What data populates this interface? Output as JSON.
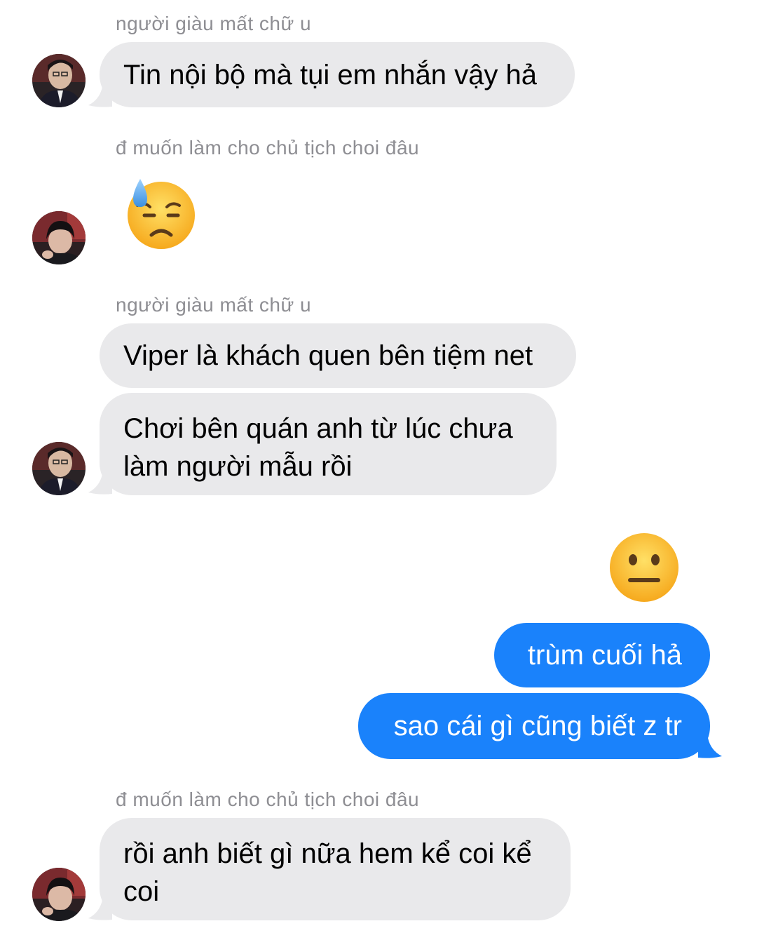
{
  "messages": [
    {
      "sender": "người giàu mất chữ u",
      "text": "Tin nội bộ mà tụi em nhắn vậy hả"
    },
    {
      "sender": "đ muốn làm cho chủ tịch choi đâu",
      "emoji": "downcast-face-with-sweat-emoji"
    },
    {
      "sender": "người giàu mất chữ u",
      "text": "Viper là khách quen bên tiệm net"
    },
    {
      "line1": "Chơi bên quán anh từ lúc chưa",
      "line2": "làm người mẫu rồi"
    },
    {
      "emoji": "neutral-face-emoji"
    },
    {
      "text": "trùm cuối hả"
    },
    {
      "text": "sao cái gì cũng biết z tr"
    },
    {
      "sender": "đ muốn làm cho chủ tịch choi đâu",
      "line1": "rồi anh biết gì nữa hem kể coi kể",
      "line2": "coi"
    }
  ],
  "colors": {
    "incoming_bubble": "#e9e9eb",
    "outgoing_bubble": "#1a82fb",
    "sender_name": "#8e8e93"
  }
}
